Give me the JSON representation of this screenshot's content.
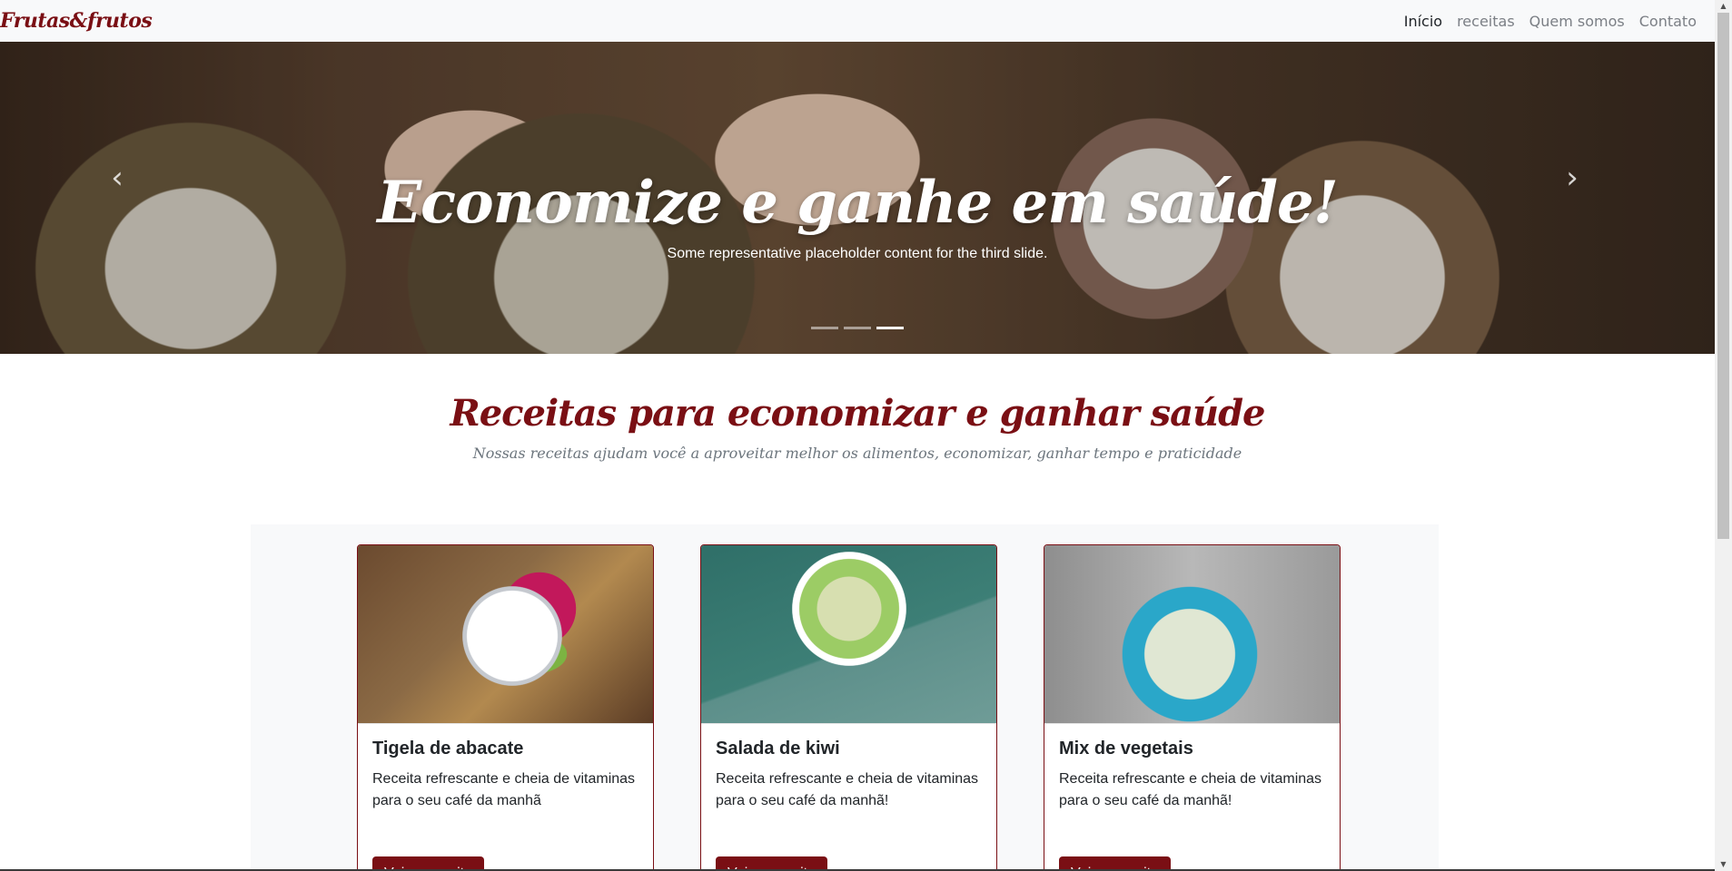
{
  "navbar": {
    "brand": "Frutas&frutos",
    "links": [
      {
        "label": "Início"
      },
      {
        "label": "receitas"
      },
      {
        "label": "Quem somos"
      },
      {
        "label": "Contato"
      }
    ]
  },
  "carousel": {
    "title": "Economize e ganhe em saúde!",
    "text": "Some representative placeholder content for the third slide.",
    "prev_icon": "‹",
    "next_icon": "›",
    "active_slide": 3,
    "slide_count": 3
  },
  "section": {
    "title": "Receitas para economizar e ganhar saúde",
    "subtitle": "Nossas receitas ajudam você a aproveitar melhor os alimentos, economizar, ganhar tempo e praticidade"
  },
  "cards": [
    {
      "title": "Tigela de abacate",
      "text": "Receita refrescante e cheia de vitaminas para o seu café da manhã",
      "button": "Veja a receita"
    },
    {
      "title": "Salada de kiwi",
      "text": "Receita refrescante e cheia de vitaminas para o seu café da manhã!",
      "button": "Veja a receita"
    },
    {
      "title": "Mix de vegetais",
      "text": "Receita refrescante e cheia de vitaminas para o seu café da manhã!",
      "button": "Veja a receita"
    }
  ],
  "colors": {
    "brand": "#7a0f14",
    "nav_bg": "#f8f9fa",
    "cards_bg": "#f8f9fa"
  }
}
